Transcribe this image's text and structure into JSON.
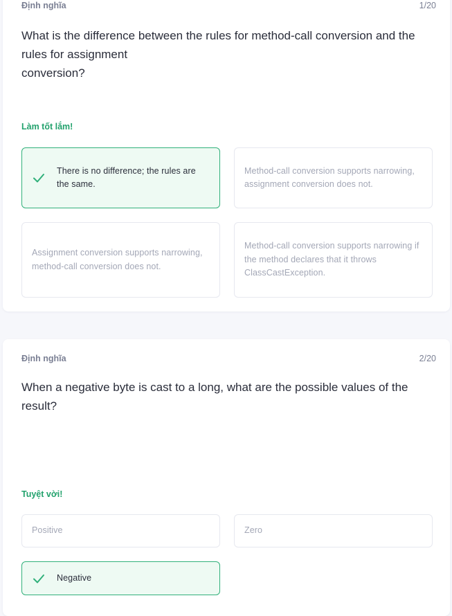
{
  "cards": [
    {
      "label": "Định nghĩa",
      "counter": "1/20",
      "question_lines": [
        "What is the difference between the rules for method-call conversion and the",
        "rules for assignment",
        "conversion?"
      ],
      "feedback": "Làm tốt lắm!",
      "options": [
        {
          "text": "There is no difference; the rules are the same.",
          "correct": true
        },
        {
          "text": "Method-call conversion supports narrowing, assignment conversion does not.",
          "correct": false
        },
        {
          "text": "Assignment conversion supports narrowing, method-call conversion does not.",
          "correct": false
        },
        {
          "text_lines": [
            "Method-call conversion supports narrowing if the method declares that it throws",
            "ClassCastException."
          ],
          "correct": false
        }
      ]
    },
    {
      "label": "Định nghĩa",
      "counter": "2/20",
      "question_lines": [
        "When a negative byte is cast to a long, what are the possible values of the",
        "result?"
      ],
      "feedback": "Tuyệt vời!",
      "options": [
        {
          "text": "Positive",
          "correct": false
        },
        {
          "text": "Zero",
          "correct": false
        },
        {
          "text": "Negative",
          "correct": true
        }
      ]
    }
  ],
  "colors": {
    "correct_green": "#23a26d",
    "correct_border": "#30b07a",
    "correct_bg": "#eefaf3",
    "muted_text": "#a3a7b6",
    "label_gray": "#7a7f93"
  },
  "icons": {
    "correct": "checkmark-icon"
  }
}
